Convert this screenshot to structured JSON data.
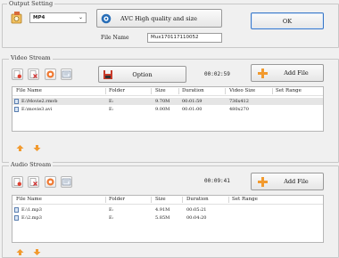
{
  "output": {
    "title": "Output Setting",
    "format_value": "MP4",
    "quality_label": "AVC High quality and size",
    "file_name_label": "File Name",
    "file_name_value": "Mux170117110052",
    "ok_label": "OK"
  },
  "video": {
    "title": "Video Stream",
    "option_label": "Option",
    "duration": "00:02:59",
    "add_file_label": "Add File",
    "columns": [
      "File Name",
      "Folder",
      "Size",
      "Duration",
      "Video Size",
      "Set Range"
    ],
    "rows": [
      {
        "name": "E:\\Movie2.rmvb",
        "folder": "E:",
        "size": "9.70M",
        "duration": "00:01:59",
        "video_size": "736x412",
        "range": ""
      },
      {
        "name": "E:\\movie3.avi",
        "folder": "E:",
        "size": "9.00M",
        "duration": "00:01:00",
        "video_size": "480x270",
        "range": ""
      }
    ]
  },
  "audio": {
    "title": "Audio Stream",
    "duration": "00:09:41",
    "add_file_label": "Add File",
    "columns": [
      "File Name",
      "Folder",
      "Size",
      "Duration",
      "Set Range"
    ],
    "rows": [
      {
        "name": "E:\\1.mp3",
        "folder": "E:",
        "size": "4.91M",
        "duration": "00:05:21",
        "range": ""
      },
      {
        "name": "E:\\2.mp3",
        "folder": "E:",
        "size": "5.85M",
        "duration": "00:04:20",
        "range": ""
      }
    ]
  },
  "colors": {
    "accent_orange": "#f29a2e",
    "selected_row": "#e5e5e5",
    "ok_border": "#3a78c8"
  }
}
